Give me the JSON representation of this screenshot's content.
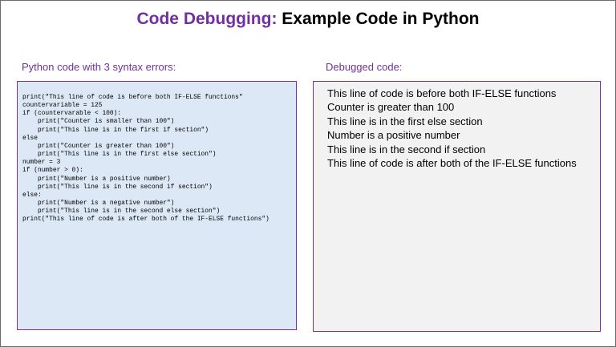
{
  "title": {
    "accent": "Code Debugging:",
    "rest": " Example Code in Python",
    "accent_color": "#7030a0"
  },
  "left_panel": {
    "label": "Python code with 3 syntax errors:",
    "background": "#dce8f5",
    "code_lines": [
      "print(\"This line of code is before both IF-ELSE functions\"",
      "countervariable = 125",
      "if (countervarable < 100):",
      "    print(\"Counter is smaller than 100\")",
      "    print(\"This line is in the first if section\")",
      "else",
      "    print(\"Counter is greater than 100\")",
      "    print(\"This line is in the first else section\")",
      "number = 3",
      "if (number > 0):",
      "    print(\"Number is a positive number)",
      "    print(\"This line is in the second if section\")",
      "else:",
      "    print(\"Number is a negative number\")",
      "    print(\"This line is in the second else section\")",
      "print(\"This line of code is after both of the IF-ELSE functions\")"
    ]
  },
  "right_panel": {
    "label": "Debugged code:",
    "background": "#f2f2f2",
    "output_lines": [
      "This line of code is before both IF-ELSE functions",
      "Counter is greater than 100",
      "This line is in the first else section",
      "Number is a positive number",
      "This line is in the second if section",
      "This line of code is after both of the IF-ELSE functions"
    ]
  }
}
